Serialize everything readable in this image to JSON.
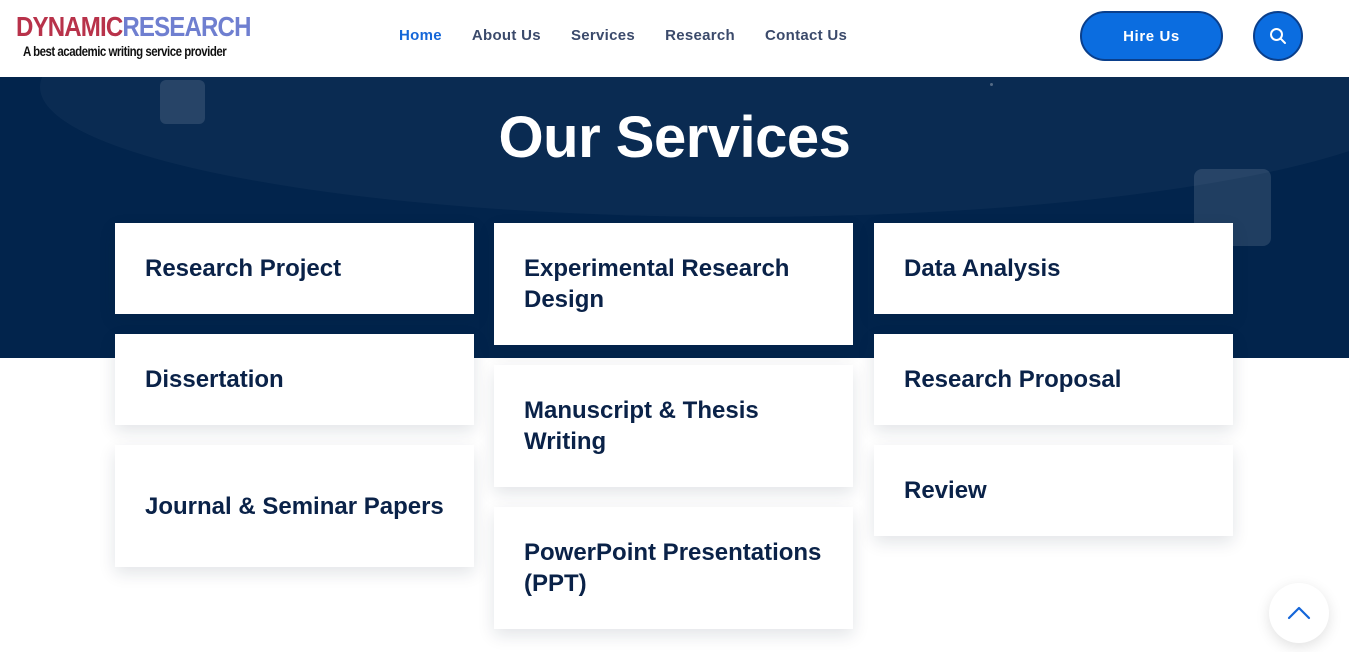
{
  "logo": {
    "title_part1": "DYNAMIC",
    "title_part2": "RESEARCH",
    "tagline": "A best academic writing service provider"
  },
  "nav": {
    "items": [
      {
        "label": "Home",
        "active": true
      },
      {
        "label": "About Us",
        "active": false
      },
      {
        "label": "Services",
        "active": false
      },
      {
        "label": "Research",
        "active": false
      },
      {
        "label": "Contact Us",
        "active": false
      }
    ]
  },
  "header": {
    "hire_label": "Hire Us",
    "search_icon": "search-icon"
  },
  "section": {
    "title": "Our Services"
  },
  "services": [
    {
      "label": "Research Project"
    },
    {
      "label": "Experimental Research Design"
    },
    {
      "label": "Data Analysis"
    },
    {
      "label": "Dissertation"
    },
    {
      "label": "Manuscript & Thesis Writing"
    },
    {
      "label": "Research Proposal"
    },
    {
      "label": "Journal & Seminar Papers"
    },
    {
      "label": "PowerPoint Presentations (PPT)"
    },
    {
      "label": "Review"
    }
  ],
  "scroll_top": {
    "icon": "chevron-up-icon"
  },
  "colors": {
    "brand_blue": "#0b6de0",
    "hero_navy": "#02244c",
    "heading_navy": "#0a2248",
    "nav_active": "#1466d8",
    "logo_red": "#b8324a",
    "logo_blue": "#6f7fd0"
  }
}
